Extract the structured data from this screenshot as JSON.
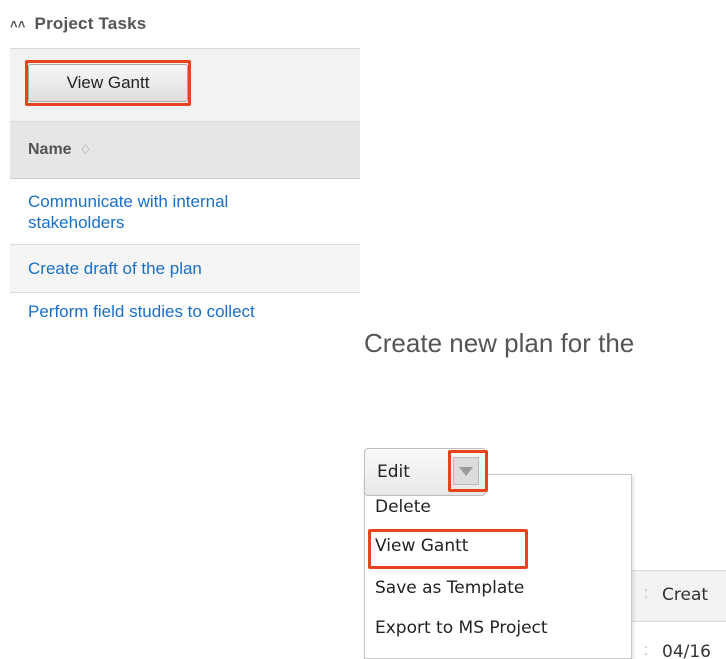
{
  "panel": {
    "title": "Project Tasks",
    "view_gantt_label": "View Gantt",
    "column_name": "Name",
    "rows": [
      {
        "line1": "Communicate with internal",
        "line2": "stakeholders"
      },
      {
        "line1": "Create draft of the plan"
      },
      {
        "line1": "Perform field studies to collect"
      }
    ]
  },
  "plan_title": "Create new plan for the",
  "edit": {
    "label": "Edit",
    "menu_items": [
      "Delete",
      "View Gantt",
      "Save as Template",
      "Export to MS Project"
    ]
  },
  "background_table": {
    "header_cell": "Creat",
    "value_cell": "04/16"
  },
  "colors": {
    "highlight": "#e8431c",
    "link": "#1a6fc7"
  },
  "icons": {
    "collapse": "double-chevron-up-icon",
    "sort": "sort-arrows-icon",
    "dropdown": "caret-down-icon"
  }
}
